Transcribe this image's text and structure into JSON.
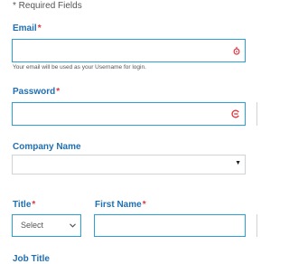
{
  "required_note": "* Required Fields",
  "email": {
    "label": "Email",
    "required_mark": "*",
    "value": "",
    "helper": "Your email will be used as your Username for login.",
    "icon": "email-validation-icon",
    "icon_color": "#e2353e"
  },
  "password": {
    "label": "Password",
    "required_mark": "*",
    "value": "",
    "icon": "password-manager-icon",
    "icon_color": "#e2353e"
  },
  "company": {
    "label": "Company Name",
    "value": ""
  },
  "title_field": {
    "label": "Title",
    "required_mark": "*",
    "selected": "Select"
  },
  "first_name": {
    "label": "First Name",
    "required_mark": "*",
    "value": ""
  },
  "job_title": {
    "label": "Job Title"
  },
  "colors": {
    "label_blue": "#1f6fb3",
    "border_blue": "#2a9fd8",
    "required_red": "#e2353e",
    "border_gray": "#cfd3d6"
  }
}
